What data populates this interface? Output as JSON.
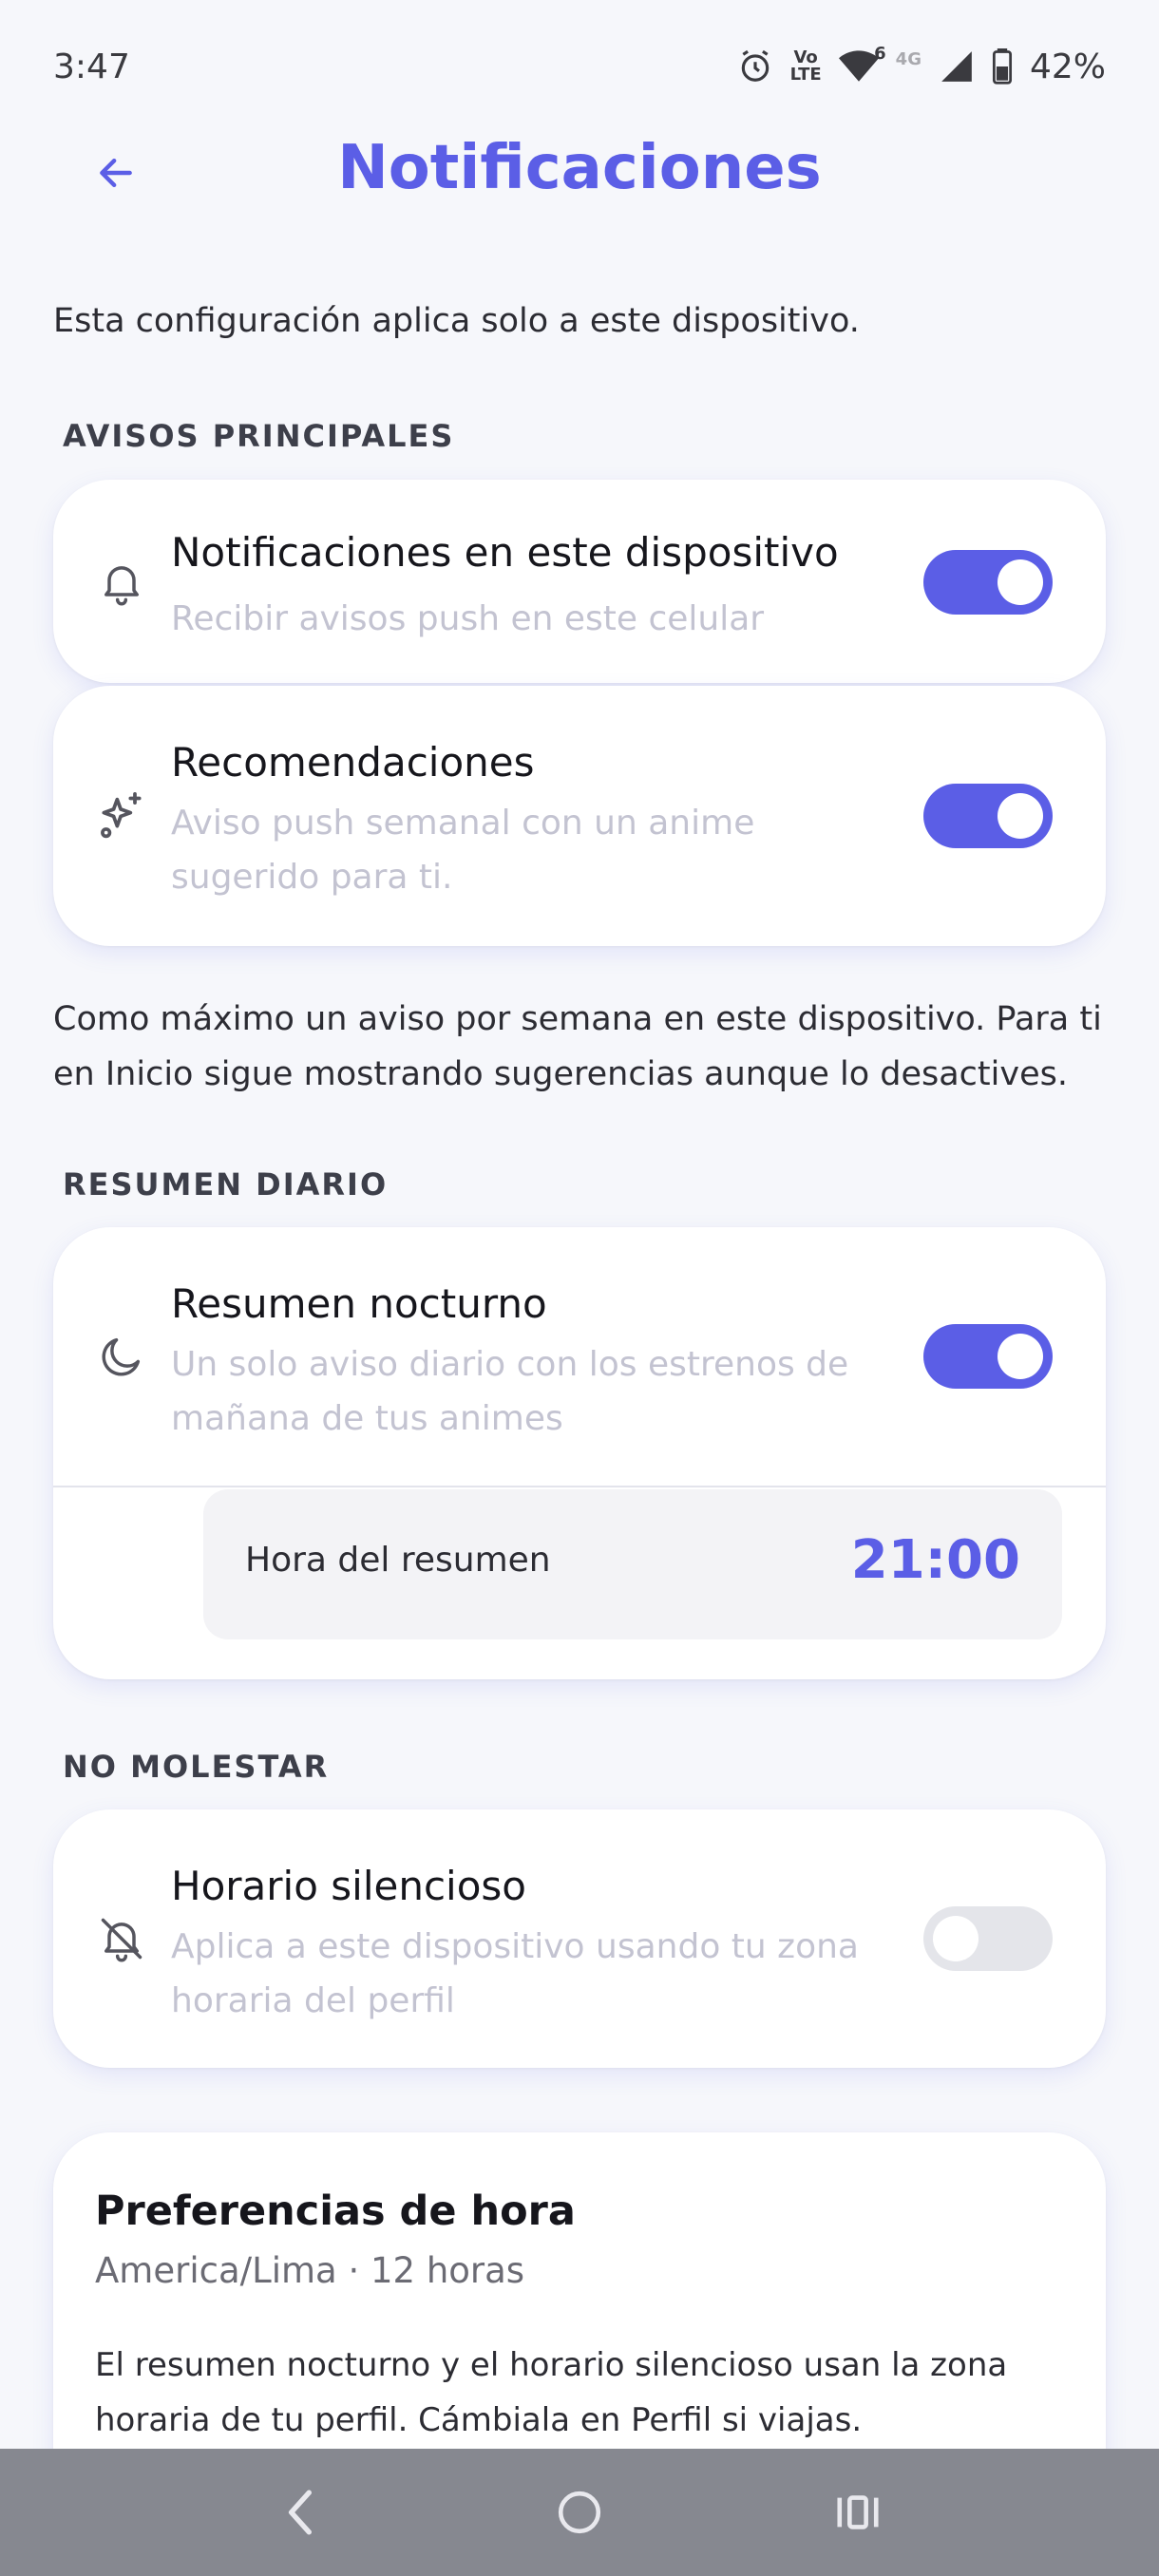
{
  "status_bar": {
    "time": "3:47",
    "volte_top": "Vo",
    "volte_bottom": "LTE",
    "wifi_badge": "6",
    "network": "4G",
    "battery": "42%"
  },
  "header": {
    "title": "Notificaciones"
  },
  "intro": "Esta configuración aplica solo a este dispositivo.",
  "sections": {
    "main": {
      "label": "AVISOS PRINCIPALES",
      "device": {
        "title": "Notificaciones en este dispositivo",
        "subtitle": "Recibir avisos push en este celular",
        "enabled": true
      },
      "recommendations": {
        "title": "Recomendaciones",
        "subtitle": "Aviso push semanal con un anime sugerido para ti.",
        "enabled": true
      },
      "note": "Como máximo un aviso por semana en este dispositivo. Para ti en Inicio sigue mostrando sugerencias aunque lo desactives."
    },
    "daily": {
      "label": "RESUMEN DIARIO",
      "nightly": {
        "title": "Resumen nocturno",
        "subtitle": "Un solo aviso diario con los estrenos de mañana de tus animes",
        "enabled": true
      },
      "time_label": "Hora del resumen",
      "time_value": "21:00"
    },
    "dnd": {
      "label": "NO MOLESTAR",
      "quiet": {
        "title": "Horario silencioso",
        "subtitle": "Aplica a este dispositivo usando tu zona horaria del perfil",
        "enabled": false
      }
    },
    "time_prefs": {
      "title": "Preferencias de hora",
      "subtitle": "America/Lima · 12 horas",
      "text": "El resumen nocturno y el horario silencioso usan la zona horaria de tu perfil. Cámbiala en Perfil si viajas."
    }
  },
  "colors": {
    "accent": "#5b5ee6",
    "toggle_off": "#e4e5ea",
    "nav_bar": "#868890"
  }
}
